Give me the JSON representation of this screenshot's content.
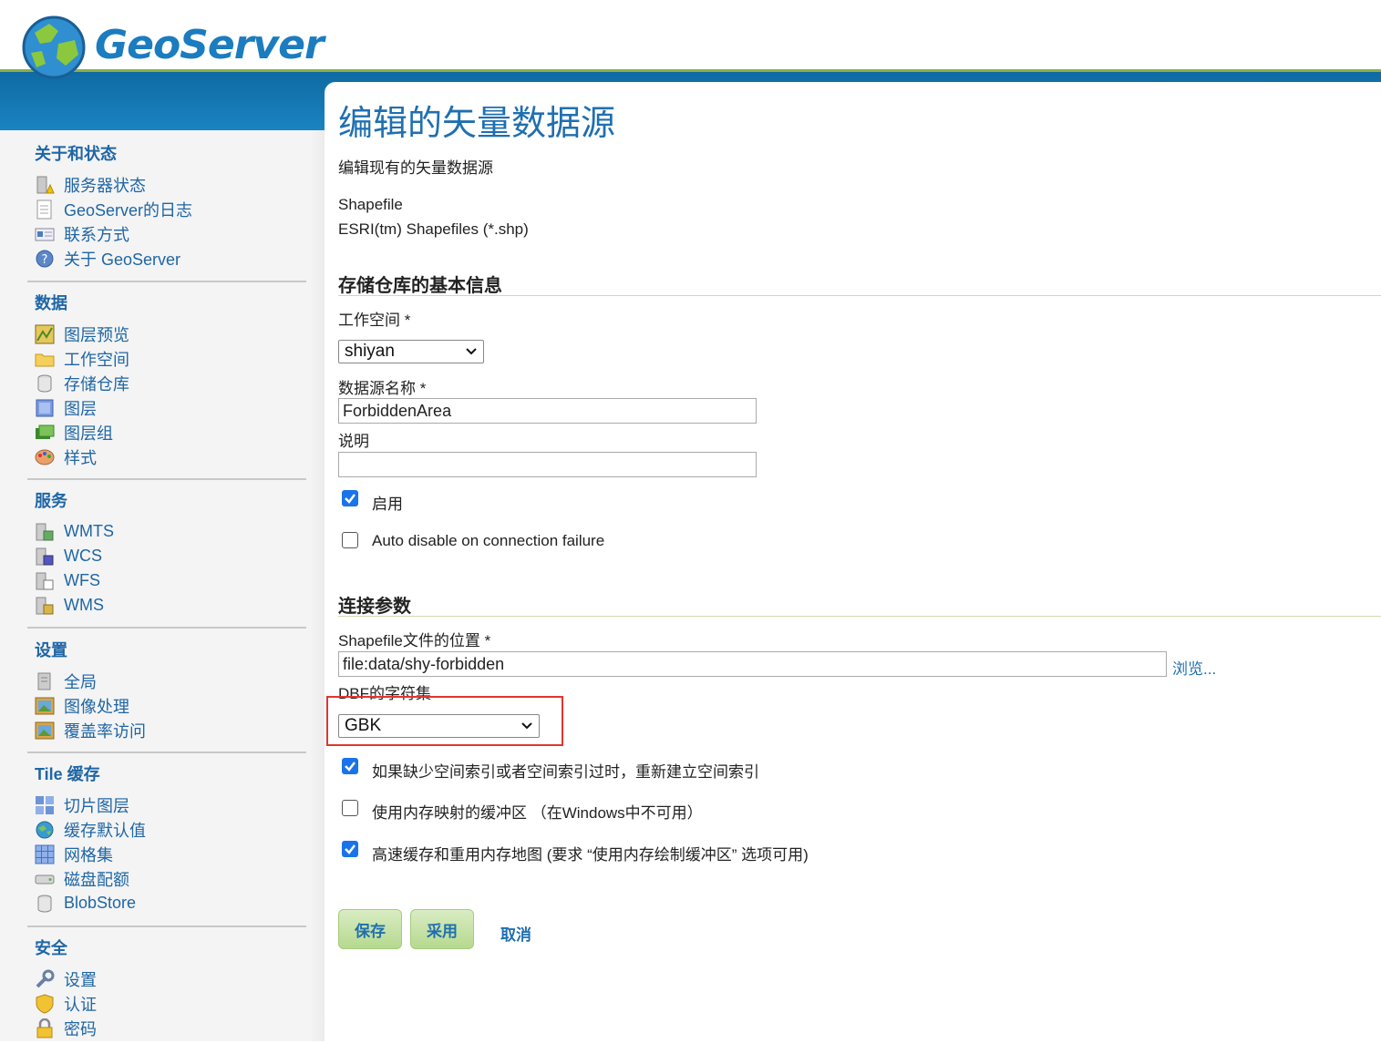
{
  "header": {
    "logo_text": "GeoServer"
  },
  "sidebar": {
    "sections": [
      {
        "title": "关于和状态",
        "items": [
          {
            "label": "服务器状态",
            "icon": "server-status-icon"
          },
          {
            "label": "GeoServer的日志",
            "icon": "log-icon"
          },
          {
            "label": "联系方式",
            "icon": "contact-icon"
          },
          {
            "label": "关于 GeoServer",
            "icon": "about-icon"
          }
        ]
      },
      {
        "title": "数据",
        "items": [
          {
            "label": "图层预览",
            "icon": "layer-preview-icon"
          },
          {
            "label": "工作空间",
            "icon": "workspace-icon"
          },
          {
            "label": "存储仓库",
            "icon": "store-icon"
          },
          {
            "label": "图层",
            "icon": "layer-icon"
          },
          {
            "label": "图层组",
            "icon": "layer-group-icon"
          },
          {
            "label": "样式",
            "icon": "style-icon"
          }
        ]
      },
      {
        "title": "服务",
        "items": [
          {
            "label": "WMTS",
            "icon": "wmts-icon"
          },
          {
            "label": "WCS",
            "icon": "wcs-icon"
          },
          {
            "label": "WFS",
            "icon": "wfs-icon"
          },
          {
            "label": "WMS",
            "icon": "wms-icon"
          }
        ]
      },
      {
        "title": "设置",
        "items": [
          {
            "label": "全局",
            "icon": "global-icon"
          },
          {
            "label": "图像处理",
            "icon": "image-processing-icon"
          },
          {
            "label": "覆盖率访问",
            "icon": "coverage-access-icon"
          }
        ]
      },
      {
        "title": "Tile 缓存",
        "items": [
          {
            "label": "切片图层",
            "icon": "tile-layers-icon"
          },
          {
            "label": "缓存默认值",
            "icon": "caching-defaults-icon"
          },
          {
            "label": "网格集",
            "icon": "gridsets-icon"
          },
          {
            "label": "磁盘配额",
            "icon": "disk-quota-icon"
          },
          {
            "label": "BlobStore",
            "icon": "blobstore-icon"
          }
        ]
      },
      {
        "title": "安全",
        "items": [
          {
            "label": "设置",
            "icon": "security-settings-icon"
          },
          {
            "label": "认证",
            "icon": "authentication-icon"
          },
          {
            "label": "密码",
            "icon": "password-icon"
          }
        ]
      }
    ]
  },
  "main": {
    "title": "编辑的矢量数据源",
    "subtitle": "编辑现有的矢量数据源",
    "store_type": "Shapefile",
    "store_desc": "ESRI(tm) Shapefiles (*.shp)",
    "basic_section": "存储仓库的基本信息",
    "workspace_label": "工作空间 *",
    "workspace_value": "shiyan",
    "name_label": "数据源名称 *",
    "name_value": "ForbiddenArea",
    "desc_label": "说明",
    "desc_value": "",
    "enabled_label": "启用",
    "enabled": true,
    "auto_disable_label": "Auto disable on connection failure",
    "auto_disable": false,
    "conn_section": "连接参数",
    "shp_location_label": "Shapefile文件的位置 *",
    "shp_location_value": "file:data/shy-forbidden",
    "browse_label": "浏览...",
    "charset_label": "DBF的字符集",
    "charset_value": "GBK",
    "opt_spatial_index": "如果缺少空间索引或者空间索引过时，重新建立空间索引",
    "opt_spatial_index_checked": true,
    "opt_memory_map": "使用内存映射的缓冲区 （在Windows中不可用）",
    "opt_memory_map_checked": false,
    "opt_cache_maps": "高速缓存和重用内存地图 (要求 “使用内存绘制缓冲区” 选项可用)",
    "opt_cache_maps_checked": true,
    "save_label": "保存",
    "apply_label": "采用",
    "cancel_label": "取消"
  },
  "colors": {
    "brand_blue": "#1f6fb0",
    "header_band": "#1a84c0",
    "highlight_red": "#e3342f",
    "check_blue": "#1a73e8"
  }
}
